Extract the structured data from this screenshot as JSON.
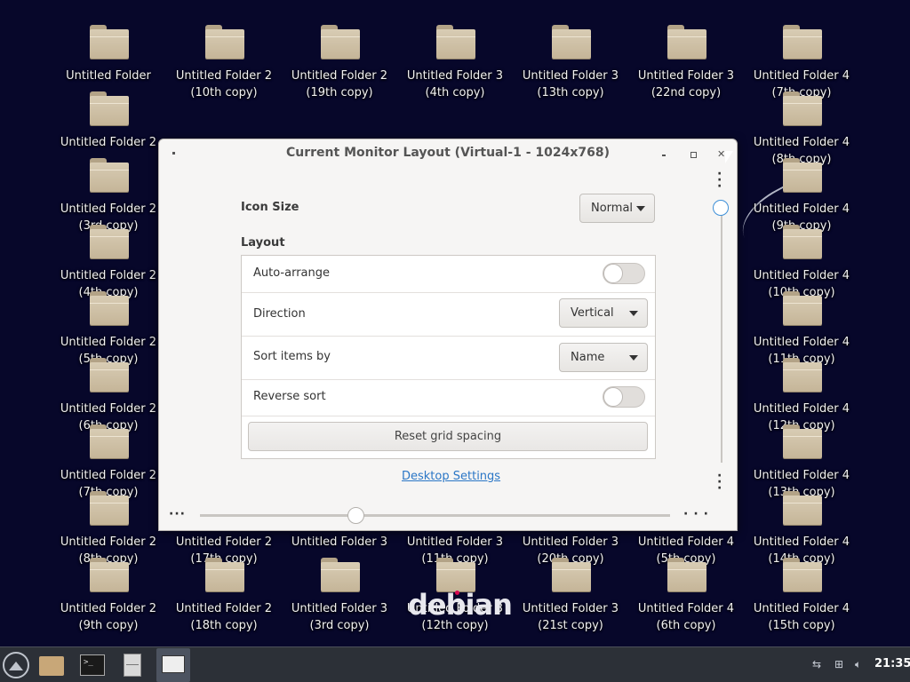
{
  "desktop": {
    "icons": [
      {
        "line1": "Untitled Folder",
        "line2": ""
      },
      {
        "line1": "Untitled Folder 2",
        "line2": "(10th copy)"
      },
      {
        "line1": "Untitled Folder 2",
        "line2": "(19th copy)"
      },
      {
        "line1": "Untitled Folder 3",
        "line2": "(4th copy)"
      },
      {
        "line1": "Untitled Folder 3",
        "line2": "(13th copy)"
      },
      {
        "line1": "Untitled Folder 3",
        "line2": "(22nd copy)"
      },
      {
        "line1": "Untitled Folder 4",
        "line2": "(7th copy)"
      },
      {
        "line1": "Untitled Folder 2",
        "line2": ""
      },
      {
        "line1": "Untitled Folder 4",
        "line2": "(8th copy)"
      },
      {
        "line1": "Untitled Folder 2",
        "line2": "(3rd copy)"
      },
      {
        "line1": "Untitled Folder 4",
        "line2": "(9th copy)"
      },
      {
        "line1": "Untitled Folder 2",
        "line2": "(4th copy)"
      },
      {
        "line1": "Untitled Folder 4",
        "line2": "(10th copy)"
      },
      {
        "line1": "Untitled Folder 2",
        "line2": "(5th copy)"
      },
      {
        "line1": "Untitled Folder 4",
        "line2": "(11th copy)"
      },
      {
        "line1": "Untitled Folder 2",
        "line2": "(6th copy)"
      },
      {
        "line1": "Untitled Folder 4",
        "line2": "(12th copy)"
      },
      {
        "line1": "Untitled Folder 2",
        "line2": "(7th copy)"
      },
      {
        "line1": "Untitled Folder 4",
        "line2": "(13th copy)"
      },
      {
        "line1": "Untitled Folder 2",
        "line2": "(8th copy)"
      },
      {
        "line1": "Untitled Folder 2",
        "line2": "(17th copy)"
      },
      {
        "line1": "Untitled Folder 3",
        "line2": ""
      },
      {
        "line1": "Untitled Folder 3",
        "line2": "(11th copy)"
      },
      {
        "line1": "Untitled Folder 3",
        "line2": "(20th copy)"
      },
      {
        "line1": "Untitled Folder 4",
        "line2": "(5th copy)"
      },
      {
        "line1": "Untitled Folder 4",
        "line2": "(14th copy)"
      },
      {
        "line1": "Untitled Folder 2",
        "line2": "(9th copy)"
      },
      {
        "line1": "Untitled Folder 2",
        "line2": "(18th copy)"
      },
      {
        "line1": "Untitled Folder 3",
        "line2": "(3rd copy)"
      },
      {
        "line1": "Untitled Folder 3",
        "line2": "(12th copy)"
      },
      {
        "line1": "Untitled Folder 3",
        "line2": "(21st copy)"
      },
      {
        "line1": "Untitled Folder 4",
        "line2": "(6th copy)"
      },
      {
        "line1": "Untitled Folder 4",
        "line2": "(15th copy)"
      }
    ],
    "watermark": "debian"
  },
  "dialog": {
    "title": "Current Monitor Layout (Virtual-1 - 1024x768)",
    "icon_size_label": "Icon Size",
    "icon_size_value": "Normal",
    "layout_heading": "Layout",
    "auto_arrange_label": "Auto-arrange",
    "auto_arrange_on": false,
    "direction_label": "Direction",
    "direction_value": "Vertical",
    "sort_label": "Sort items by",
    "sort_value": "Name",
    "reverse_label": "Reverse sort",
    "reverse_on": false,
    "reset_button": "Reset grid spacing",
    "settings_link": "Desktop Settings"
  },
  "taskbar": {
    "clock": "21:35",
    "terminal_glyph": ">_"
  }
}
